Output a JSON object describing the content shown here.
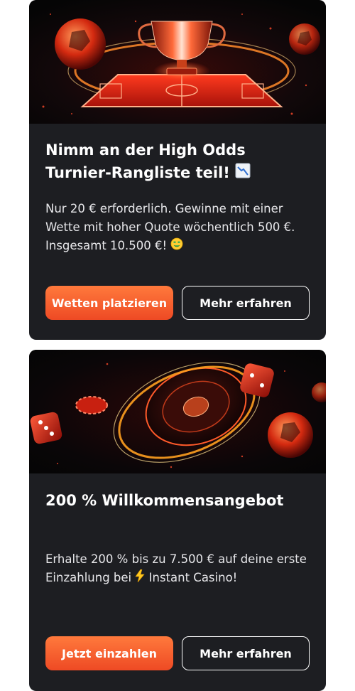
{
  "promos": [
    {
      "title_line1": "Nimm an der High Odds",
      "title_line2": "Turnier-Rangliste teil!",
      "title_icon": "chart-decreasing-icon",
      "description_line1": "Nur 20 € erforderlich. Gewinne mit einer",
      "description_line2": "Wette mit hoher Quote wöchentlich 500 €.",
      "description_line3": "Insgesamt 10.500 €!",
      "description_icon": "money-mouth-face-icon",
      "primary_button": "Wetten platzieren",
      "secondary_button": "Mehr erfahren",
      "banner_icon": "trophy-football-banner"
    },
    {
      "title": "200 % Willkommensangebot",
      "description_line1": "Erhalte 200 % bis zu 7.500 € auf deine erste",
      "description_line2_before": "Einzahlung bei",
      "description_icon": "lightning-icon",
      "description_line2_after": "Instant Casino!",
      "primary_button": "Jetzt einzahlen",
      "secondary_button": "Mehr erfahren",
      "banner_icon": "roulette-casino-banner"
    }
  ],
  "colors": {
    "card_bg": "#1d1e22",
    "accent_start": "#ff7a3c",
    "accent_end": "#ee4a24",
    "text": "#ffffff"
  }
}
